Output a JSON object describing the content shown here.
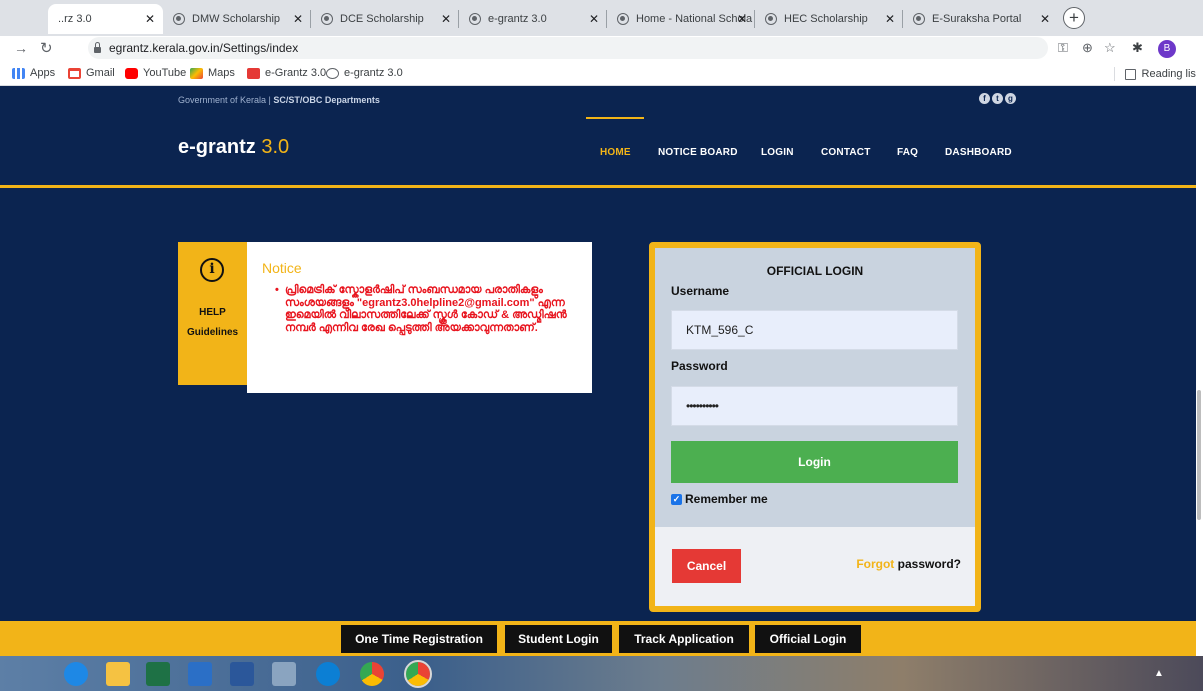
{
  "browser": {
    "tabs": [
      {
        "title": "..rz 3.0",
        "active": true
      },
      {
        "title": "DMW Scholarship"
      },
      {
        "title": "DCE Scholarship"
      },
      {
        "title": "e-grantz 3.0"
      },
      {
        "title": "Home - National Schola"
      },
      {
        "title": "HEC Scholarship"
      },
      {
        "title": "E-Suraksha Portal"
      }
    ],
    "new_tab": "+",
    "url": "egrantz.kerala.gov.in/Settings/index",
    "profile_initial": "B",
    "bookmarks": [
      "Apps",
      "Gmail",
      "YouTube",
      "Maps",
      "e-Grantz 3.0",
      "e-grantz 3.0"
    ],
    "reading_list": "Reading list",
    "colors": {
      "tab_strip": "#dee1e6",
      "profile": "#6d38c9"
    }
  },
  "site": {
    "gov_text_1": "Government of Kerala | ",
    "gov_text_2": "SC/ST/OBC Departments",
    "logo_main": "e-grantz",
    "logo_version": " 3.0",
    "menu": [
      "HOME",
      "NOTICE BOARD",
      "LOGIN",
      "CONTACT",
      "FAQ",
      "DASHBOARD"
    ],
    "active_menu": "HOME",
    "help_label": "HELP",
    "help_sub": "Guidelines",
    "notice_title": "Notice",
    "notice_text": "പ്രിമെട്രിക് സ്കോളർഷിപ് സംബന്ധമായ പരാതികളും സംശയങ്ങളും \"egrantz3.0helpline2@gmail.com\" എന്ന ഇമെയിൽ വിലാസത്തിലേക്ക് സ്കൂൾ കോഡ് & അഡ്മിഷൻ നമ്പർ എന്നിവ രേഖ പ്പെടുത്തി അയക്കാവുന്നതാണ്.",
    "login": {
      "title": "OFFICIAL LOGIN",
      "username_label": "Username",
      "username_value": "KTM_596_C",
      "password_label": "Password",
      "password_value": "••••••••••",
      "login_button": "Login",
      "remember_label": "Remember me",
      "remember_checked": true,
      "cancel_button": "Cancel",
      "forgot_1": "Forgot",
      "forgot_2": " password?"
    },
    "footer_buttons": [
      "One Time Registration",
      "Student Login",
      "Track Application",
      "Official Login"
    ],
    "colors": {
      "navy": "#0b2450",
      "accent": "#f2b418",
      "login_green": "#4caf50",
      "cancel_red": "#e53935",
      "notice_red": "#e8141e"
    }
  }
}
